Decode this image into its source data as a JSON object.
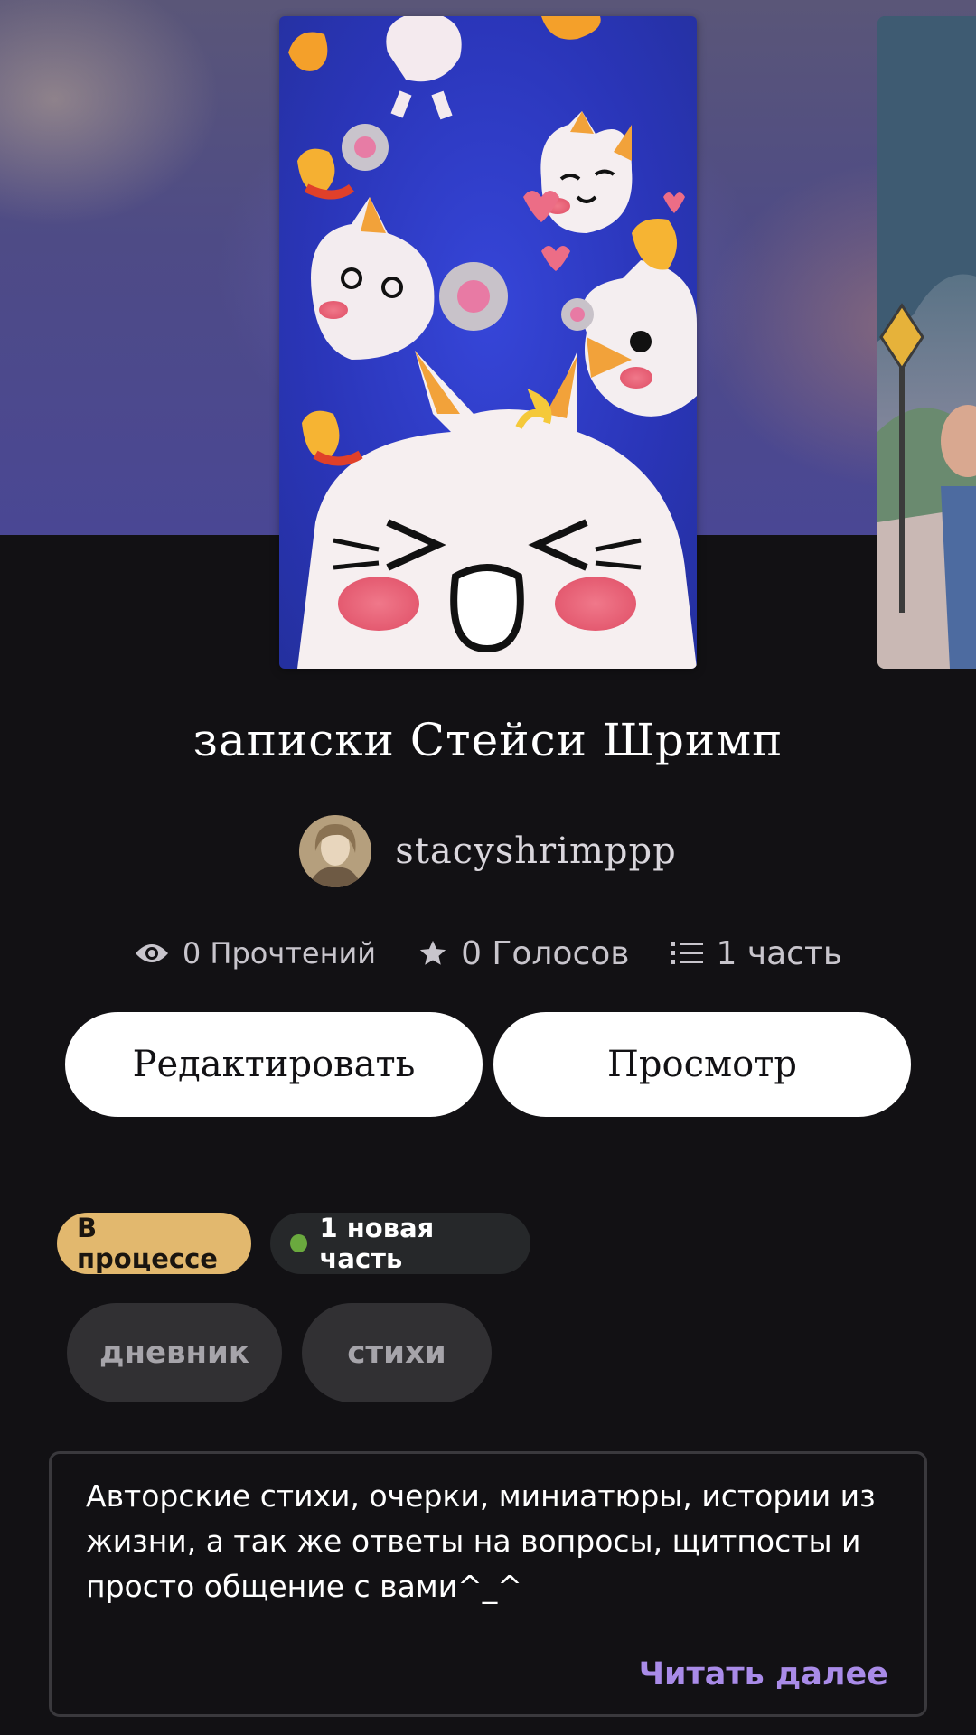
{
  "story": {
    "title": "записки Стейси Шримп",
    "author": "stacyshrimppp"
  },
  "stats": {
    "reads": "0 Прочтений",
    "votes": "0 Голосов",
    "parts": "1 часть"
  },
  "actions": {
    "edit_label": "Редактировать",
    "preview_label": "Просмотр"
  },
  "badges": {
    "status": "В процессе",
    "new_parts": "1 новая часть"
  },
  "tags": [
    "дневник",
    "стихи"
  ],
  "description": {
    "text": "Авторские стихи, очерки, миниатюры, истории из жизни, а так же ответы на вопросы, щитпосты и просто общение с вами^_^",
    "read_more": "Читать далее"
  },
  "colors": {
    "background": "#121114",
    "status_badge": "#e2b86e",
    "new_dot": "#6aa93e",
    "link": "#a98be8"
  },
  "icons": {
    "reads": "eye-icon",
    "votes": "star-icon",
    "parts": "list-icon"
  }
}
